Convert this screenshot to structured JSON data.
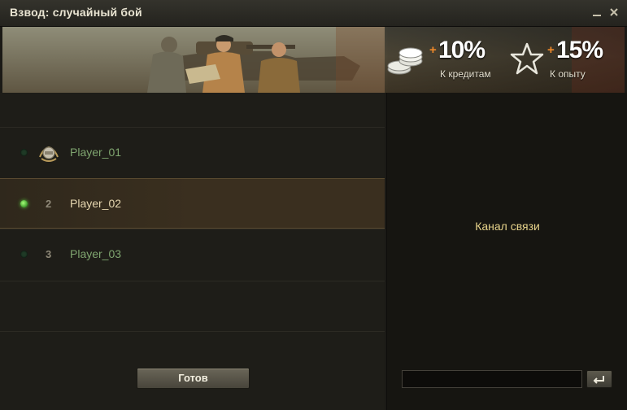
{
  "window": {
    "title": "Взвод: случайный бой",
    "minimize_icon": "minimize-icon",
    "close_icon": "close-icon"
  },
  "banner": {
    "credits_bonus": {
      "plus": "+",
      "percent": "10%",
      "label": "К кредитам",
      "icon": "coins-icon"
    },
    "xp_bonus": {
      "plus": "+",
      "percent": "15%",
      "label": "К опыту",
      "icon": "star-icon"
    }
  },
  "roster": {
    "slots": [
      {
        "number": "",
        "name": "Player_01",
        "ready": false,
        "commander": true,
        "selected": false
      },
      {
        "number": "2",
        "name": "Player_02",
        "ready": true,
        "commander": false,
        "selected": true
      },
      {
        "number": "3",
        "name": "Player_03",
        "ready": false,
        "commander": false,
        "selected": false
      }
    ],
    "ready_button": "Готов"
  },
  "chat": {
    "title": "Канал связи",
    "input_value": "",
    "send_icon": "enter-icon"
  },
  "colors": {
    "accent": "#f08a2a",
    "chat_title": "#e6d28a",
    "player_name": "#7fa56f",
    "self_name": "#e6d7b0"
  }
}
